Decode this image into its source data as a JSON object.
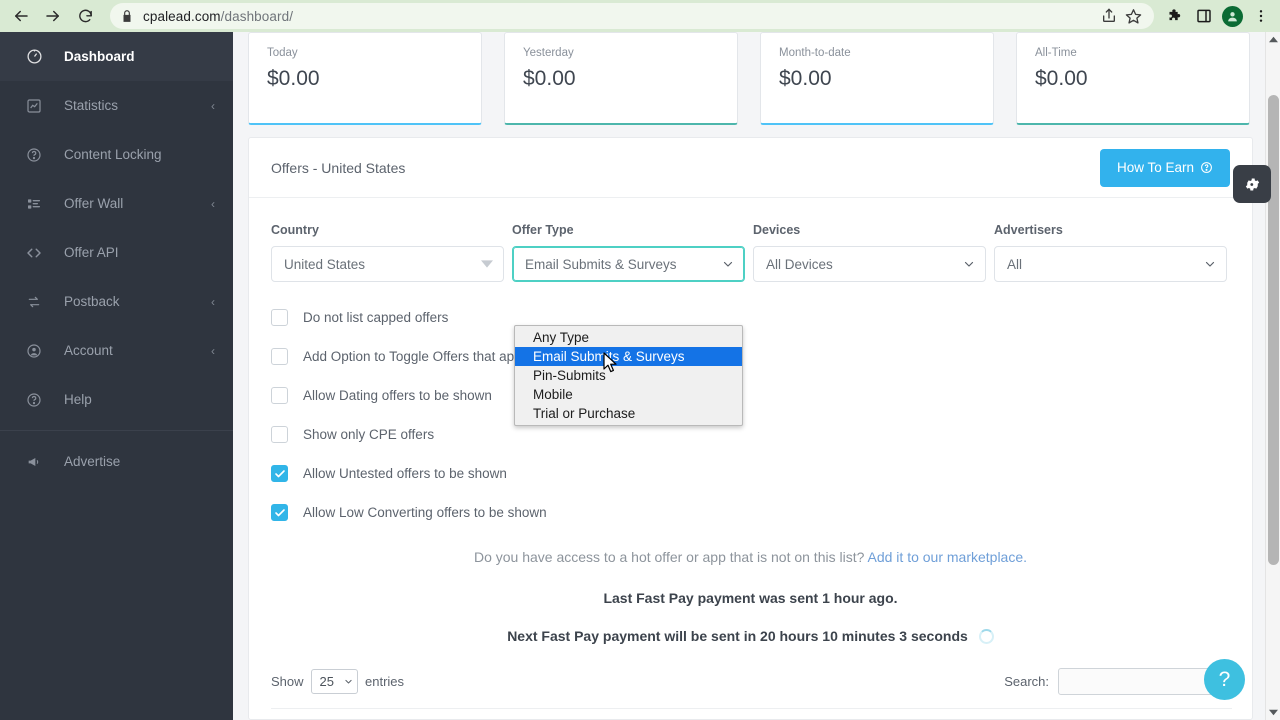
{
  "browser": {
    "back_icon": "back-arrow-icon",
    "forward_icon": "forward-arrow-icon",
    "reload_icon": "reload-icon",
    "lock_icon": "lock-icon",
    "url_domain": "cpalead.com",
    "url_path": "/dashboard/",
    "share_icon": "share-icon",
    "bookmark_icon": "star-icon",
    "extensions_icon": "puzzle-icon",
    "sidepanel_icon": "side-panel-icon",
    "avatar_icon": "profile-avatar",
    "menu_icon": "three-dot-menu-icon"
  },
  "sidebar": {
    "items": [
      {
        "label": "Dashboard",
        "icon": "speedometer-icon",
        "active": true,
        "expandable": false
      },
      {
        "label": "Statistics",
        "icon": "chart-icon",
        "active": false,
        "expandable": true
      },
      {
        "label": "Content Locking",
        "icon": "question-circle-icon",
        "active": false,
        "expandable": false
      },
      {
        "label": "Offer Wall",
        "icon": "list-icon",
        "active": false,
        "expandable": true
      },
      {
        "label": "Offer API",
        "icon": "code-brackets-icon",
        "active": false,
        "expandable": false
      },
      {
        "label": "Postback",
        "icon": "exchange-icon",
        "active": false,
        "expandable": true
      },
      {
        "label": "Account",
        "icon": "user-circle-icon",
        "active": false,
        "expandable": true
      },
      {
        "label": "Help",
        "icon": "question-circle-icon",
        "active": false,
        "expandable": false
      }
    ],
    "advertise": {
      "label": "Advertise",
      "icon": "megaphone-icon"
    },
    "chevron": "‹"
  },
  "stats": {
    "cards": [
      {
        "label": "Today",
        "value": "$0.00",
        "accent": "#4fc3f7"
      },
      {
        "label": "Yesterday",
        "value": "$0.00",
        "accent": "#4db6ac"
      },
      {
        "label": "Month-to-date",
        "value": "$0.00",
        "accent": "#4fc3f7"
      },
      {
        "label": "All-Time",
        "value": "$0.00",
        "accent": "#4db6ac"
      }
    ]
  },
  "offers": {
    "title": "Offers - United States",
    "how_to_earn": "How To Earn",
    "how_to_earn_icon": "❓",
    "settings_icon": "gear-icon",
    "filters": [
      {
        "label": "Country",
        "value": "United States",
        "focused": false
      },
      {
        "label": "Offer Type",
        "value": "Email Submits & Surveys",
        "focused": true
      },
      {
        "label": "Devices",
        "value": "All Devices",
        "focused": false
      },
      {
        "label": "Advertisers",
        "value": "All",
        "focused": false
      }
    ],
    "offer_type_options": [
      {
        "label": "Any Type",
        "selected": false
      },
      {
        "label": "Email Submits & Surveys",
        "selected": true
      },
      {
        "label": "Pin-Submits",
        "selected": false
      },
      {
        "label": "Mobile",
        "selected": false
      },
      {
        "label": "Trial or Purchase",
        "selected": false
      }
    ],
    "checkboxes": [
      {
        "label": "Do not list capped offers",
        "checked": false
      },
      {
        "label": "Add Option to Toggle Offers that app",
        "checked": false
      },
      {
        "label": "Allow Dating offers to be shown",
        "checked": false
      },
      {
        "label": "Show only CPE offers",
        "checked": false
      },
      {
        "label": "Allow Untested offers to be shown",
        "checked": true
      },
      {
        "label": "Allow Low Converting offers to be shown",
        "checked": true
      }
    ],
    "marketplace_text": "Do you have access to a hot offer or app that is not on this list? ",
    "marketplace_link": "Add it to our marketplace.",
    "last_payment": "Last Fast Pay payment was sent 1 hour ago.",
    "next_payment": "Next Fast Pay payment will be sent in 20 hours 10 minutes 3 seconds"
  },
  "table": {
    "show_label": "Show",
    "entries_value": "25",
    "entries_label": "entries",
    "search_label": "Search:",
    "search_value": "",
    "search_placeholder": ""
  },
  "help": {
    "label": "?"
  },
  "scrollbar": {
    "up_icon": "scroll-up-arrow",
    "down_icon": "scroll-down-arrow"
  }
}
